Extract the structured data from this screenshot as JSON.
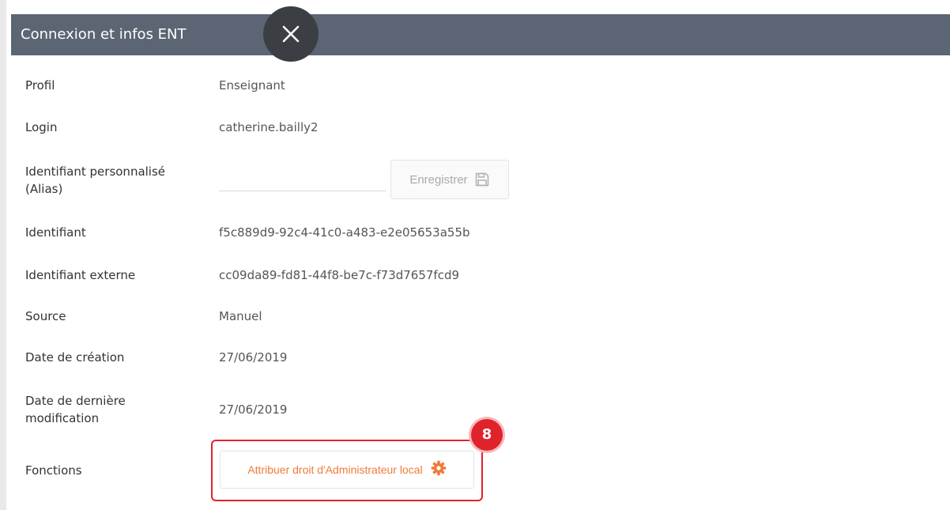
{
  "panel": {
    "title": "Connexion et infos ENT",
    "close_icon": "close-icon"
  },
  "fields": {
    "profil": {
      "label": "Profil",
      "value": "Enseignant"
    },
    "login": {
      "label": "Login",
      "value": "catherine.bailly2"
    },
    "alias": {
      "label_line1": "Identifiant personnalisé",
      "label_line2": "(Alias)",
      "value": "",
      "placeholder": "",
      "save_label": "Enregistrer",
      "save_icon": "floppy-disk-icon"
    },
    "identifiant": {
      "label": "Identifiant",
      "value": "f5c889d9-92c4-41c0-a483-e2e05653a55b"
    },
    "identifiant_externe": {
      "label": "Identifiant externe",
      "value": "cc09da89-fd81-44f8-be7c-f73d7657fcd9"
    },
    "source": {
      "label": "Source",
      "value": "Manuel"
    },
    "date_creation": {
      "label": "Date de création",
      "value": "27/06/2019"
    },
    "date_modif": {
      "label_line1": "Date de dernière",
      "label_line2": "modification",
      "value": "27/06/2019"
    },
    "fonctions": {
      "label": "Fonctions",
      "admin_button_label": "Attribuer droit d'Administrateur local",
      "admin_button_icon": "gear-icon"
    }
  },
  "annotation": {
    "step_number": "8"
  },
  "colors": {
    "header_bg": "#5b6573",
    "close_bg": "#3b3f44",
    "accent_orange": "#f07a3a",
    "highlight_red": "#e0232b"
  }
}
